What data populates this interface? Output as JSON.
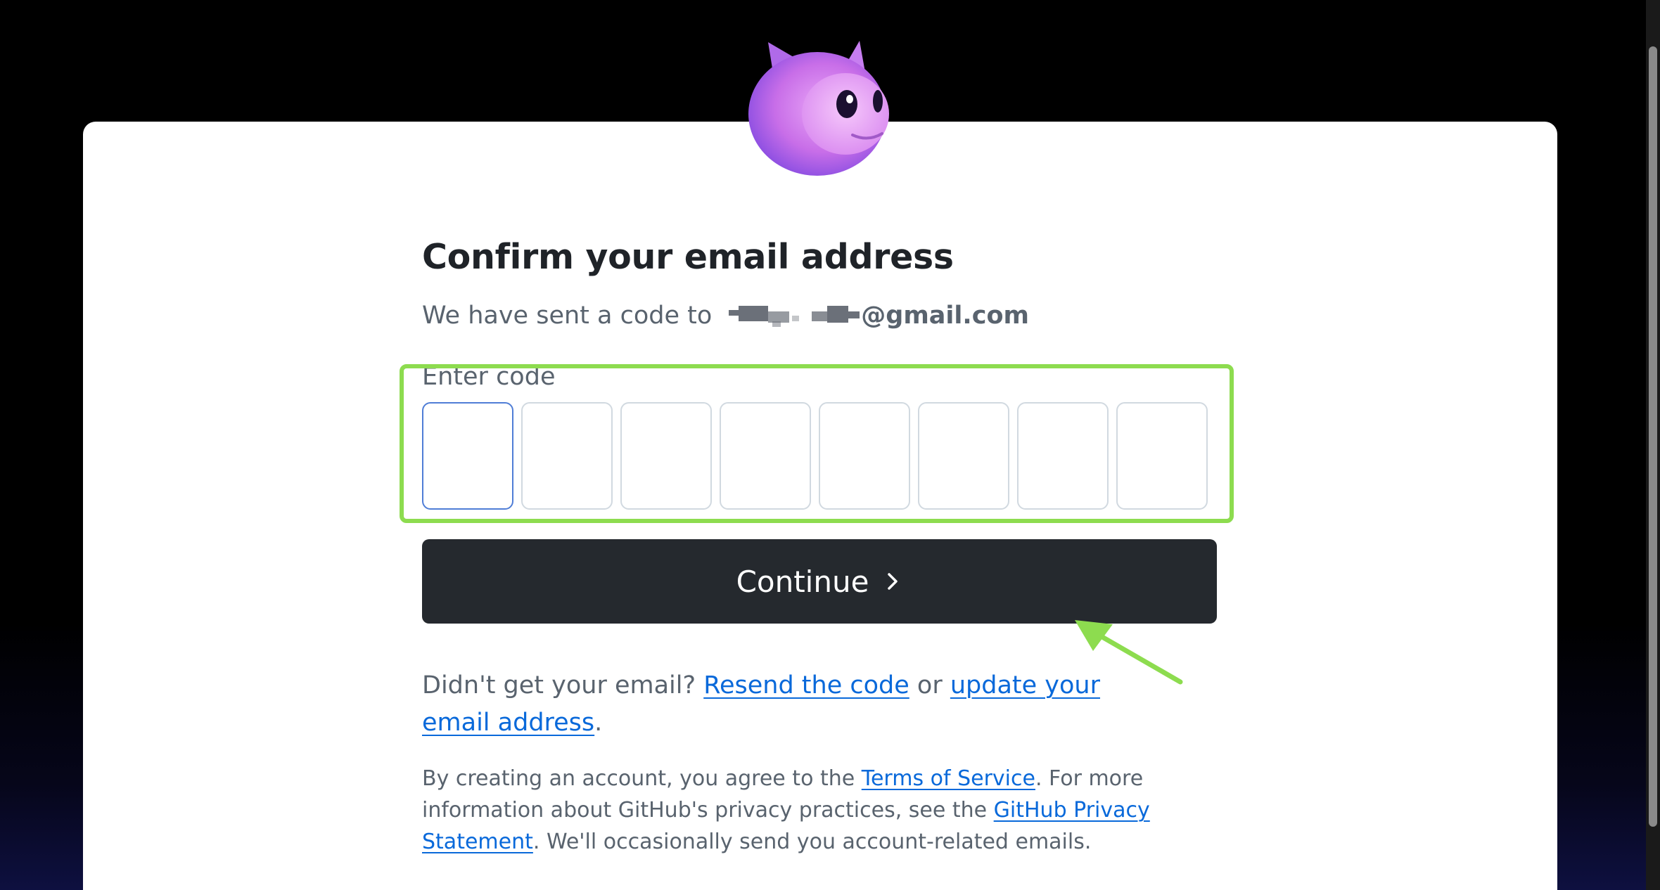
{
  "heading": "Confirm your email address",
  "sent": {
    "prefix": "We have sent a code to",
    "email_visible": "@gmail.com"
  },
  "code": {
    "label": "Enter code",
    "box_count": 8,
    "values": [
      "",
      "",
      "",
      "",
      "",
      "",
      "",
      ""
    ]
  },
  "continue_label": "Continue",
  "resend": {
    "prefix": "Didn't get your email?",
    "resend_link": "Resend the code",
    "or_text": "or",
    "update_link": "update your email address",
    "suffix": "."
  },
  "legal": {
    "part1": "By creating an account, you agree to the",
    "terms_link": "Terms of Service",
    "part2": ". For more information about GitHub's privacy practices, see the",
    "privacy_link": "GitHub Privacy Statement",
    "part3": ". We'll occasionally send you account-related emails."
  },
  "colors": {
    "highlight": "#8ddc4f",
    "button": "#25292e",
    "link": "#0969da",
    "mascot": "#c86ee8"
  },
  "icons": {
    "mascot": "copilot-mascot-icon",
    "continue_chevron": "chevron-right-icon",
    "annotation": "annotation-arrow-icon"
  }
}
